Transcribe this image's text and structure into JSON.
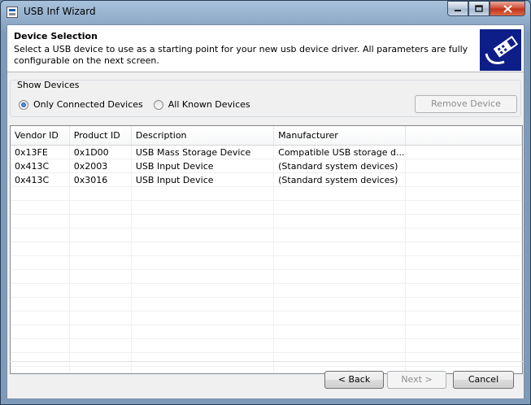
{
  "window": {
    "title": "USB Inf Wizard"
  },
  "header": {
    "title": "Device Selection",
    "description": "Select a USB device to use as a starting point for your new usb device driver.  All parameters are fully configurable on the next screen."
  },
  "show_devices": {
    "label": "Show Devices",
    "options": [
      {
        "label": "Only Connected Devices",
        "selected": true
      },
      {
        "label": "All Known Devices",
        "selected": false
      }
    ],
    "remove_label": "Remove Device"
  },
  "table": {
    "columns": [
      "Vendor ID",
      "Product ID",
      "Description",
      "Manufacturer"
    ],
    "rows": [
      [
        "0x13FE",
        "0x1D00",
        "USB Mass Storage Device",
        "Compatible USB storage d..."
      ],
      [
        "0x413C",
        "0x2003",
        "USB Input Device",
        "(Standard system devices)"
      ],
      [
        "0x413C",
        "0x3016",
        "USB Input Device",
        "(Standard system devices)"
      ]
    ]
  },
  "footer": {
    "back_label": "< Back",
    "next_label": "Next >",
    "cancel_label": "Cancel"
  },
  "colors": {
    "accent": "#1c4f9a",
    "logo_bg": "#0d1e88"
  },
  "icons": [
    "app-icon",
    "minimize-icon",
    "maximize-icon",
    "close-icon",
    "usb-cable-icon"
  ]
}
